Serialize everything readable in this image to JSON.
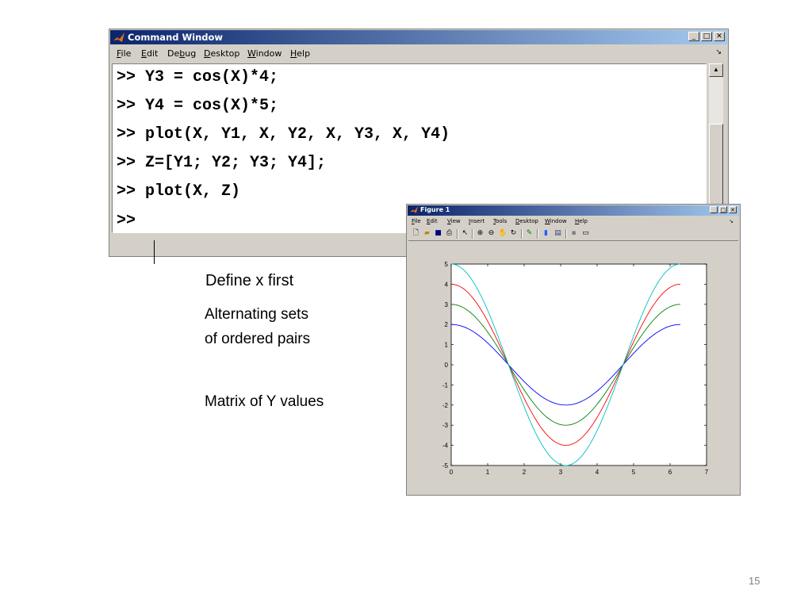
{
  "command_window": {
    "title": "Command Window",
    "menu": [
      {
        "key": "F",
        "rest": "ile"
      },
      {
        "key": "E",
        "rest": "dit"
      },
      {
        "pre": "De",
        "key": "b",
        "rest": "ug"
      },
      {
        "key": "D",
        "rest": "esktop"
      },
      {
        "key": "W",
        "rest": "indow"
      },
      {
        "key": "H",
        "rest": "elp"
      }
    ],
    "lines": [
      ">> Y3 = cos(X)*4;",
      ">> Y4 = cos(X)*5;",
      ">> plot(X, Y1, X, Y2, X, Y3, X, Y4)",
      ">> Z=[Y1; Y2; Y3; Y4];",
      ">> plot(X, Z)",
      ">>"
    ]
  },
  "annotations": {
    "define_x": "Define x first",
    "alternating_line1": "Alternating sets",
    "alternating_line2": "of ordered pairs",
    "matrix": "Matrix of Y values"
  },
  "page_number": "15",
  "figure_window": {
    "title": "Figure 1",
    "menu": [
      {
        "key": "F",
        "rest": "ile"
      },
      {
        "key": "E",
        "rest": "dit"
      },
      {
        "key": "V",
        "rest": "iew"
      },
      {
        "key": "I",
        "rest": "nsert"
      },
      {
        "key": "T",
        "rest": "ools"
      },
      {
        "key": "D",
        "rest": "esktop"
      },
      {
        "key": "W",
        "rest": "indow"
      },
      {
        "key": "H",
        "rest": "elp"
      }
    ],
    "toolbar_icons": [
      "new-file-icon",
      "open-folder-icon",
      "save-icon",
      "print-icon",
      "pointer-icon",
      "zoom-in-icon",
      "zoom-out-icon",
      "pan-hand-icon",
      "rotate-3d-icon",
      "data-cursor-icon",
      "colorbar-icon",
      "legend-icon",
      "hide-plot-tools-icon",
      "show-plot-tools-icon"
    ]
  },
  "chart_data": {
    "type": "line",
    "title": "",
    "xlabel": "",
    "ylabel": "",
    "xlim": [
      0,
      7
    ],
    "ylim": [
      -5,
      5
    ],
    "xticks": [
      "0",
      "1",
      "2",
      "3",
      "4",
      "5",
      "6",
      "7"
    ],
    "yticks": [
      "5",
      "4",
      "3",
      "2",
      "1",
      "0",
      "-1",
      "-2",
      "-3",
      "-4",
      "-5"
    ],
    "grid": false,
    "x_range": [
      0,
      6.2832
    ],
    "series": [
      {
        "formula": "cos(X)*2",
        "amplitude": 2,
        "color": "#0000ff"
      },
      {
        "formula": "cos(X)*3",
        "amplitude": 3,
        "color": "#008000"
      },
      {
        "formula": "cos(X)*4",
        "amplitude": 4,
        "color": "#ff0000"
      },
      {
        "formula": "cos(X)*5",
        "amplitude": 5,
        "color": "#00bfbf"
      }
    ]
  }
}
